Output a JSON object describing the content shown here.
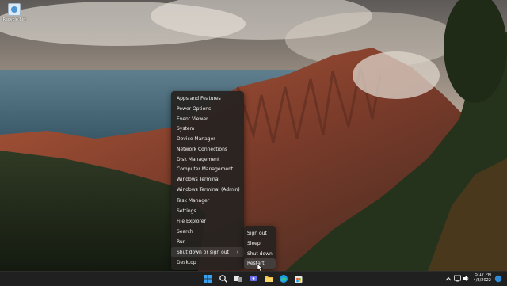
{
  "desktop": {
    "icons": [
      {
        "label": "Recycle Bin",
        "icon": "recycle-bin-icon"
      }
    ]
  },
  "winx_menu": {
    "items": [
      {
        "label": "Apps and Features"
      },
      {
        "label": "Power Options"
      },
      {
        "label": "Event Viewer"
      },
      {
        "label": "System"
      },
      {
        "label": "Device Manager"
      },
      {
        "label": "Network Connections"
      },
      {
        "label": "Disk Management"
      },
      {
        "label": "Computer Management"
      },
      {
        "label": "Windows Terminal"
      },
      {
        "label": "Windows Terminal (Admin)"
      },
      {
        "label": "Task Manager"
      },
      {
        "label": "Settings"
      },
      {
        "label": "File Explorer"
      },
      {
        "label": "Search"
      },
      {
        "label": "Run"
      },
      {
        "label": "Shut down or sign out",
        "submenu": true,
        "chevron": "›"
      },
      {
        "label": "Desktop"
      }
    ]
  },
  "power_submenu": {
    "items": [
      {
        "label": "Sign out"
      },
      {
        "label": "Sleep"
      },
      {
        "label": "Shut down"
      },
      {
        "label": "Restart"
      }
    ]
  },
  "taskbar": {
    "icons": [
      "start-icon",
      "search-icon",
      "task-view-icon",
      "chat-icon",
      "file-explorer-icon",
      "edge-icon",
      "store-icon",
      "calendar-app-icon"
    ],
    "tray_icons": [
      "chevron-up-icon",
      "network-icon",
      "volume-icon"
    ],
    "time": "5:17 PM",
    "date": "4/8/2022"
  }
}
